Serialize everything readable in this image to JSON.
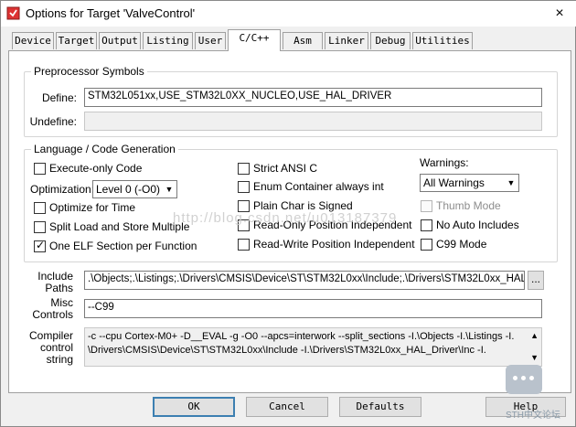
{
  "window": {
    "title": "Options for Target 'ValveControl'",
    "close_glyph": "×"
  },
  "tabs": [
    {
      "label": "Device"
    },
    {
      "label": "Target"
    },
    {
      "label": "Output"
    },
    {
      "label": "Listing"
    },
    {
      "label": "User"
    },
    {
      "label": "C/C++",
      "active": true
    },
    {
      "label": "Asm"
    },
    {
      "label": "Linker"
    },
    {
      "label": "Debug"
    },
    {
      "label": "Utilities"
    }
  ],
  "preprocessor": {
    "title": "Preprocessor Symbols",
    "define_label": "Define:",
    "define_value": "STM32L051xx,USE_STM32L0XX_NUCLEO,USE_HAL_DRIVER",
    "undefine_label": "Undefine:",
    "undefine_value": ""
  },
  "langgen": {
    "title": "Language / Code Generation",
    "execute_only": {
      "label": "Execute-only Code",
      "checked": false
    },
    "optimization_label": "Optimization:",
    "optimization_value": "Level 0 (-O0)",
    "optimize_time": {
      "label": "Optimize for Time",
      "checked": false
    },
    "split_load": {
      "label": "Split Load and Store Multiple",
      "checked": false
    },
    "one_elf": {
      "label": "One ELF Section per Function",
      "checked": true
    },
    "strict_ansi": {
      "label": "Strict ANSI C",
      "checked": false
    },
    "enum_container": {
      "label": "Enum Container always int",
      "checked": false
    },
    "plain_char": {
      "label": "Plain Char is Signed",
      "checked": false
    },
    "ro_pos_indep": {
      "label": "Read-Only Position Independent",
      "checked": false
    },
    "rw_pos_indep": {
      "label": "Read-Write Position Independent",
      "checked": false
    },
    "warnings_label": "Warnings:",
    "warnings_value": "All Warnings",
    "thumb_mode": {
      "label": "Thumb Mode",
      "checked": false,
      "disabled": true
    },
    "no_auto_includes": {
      "label": "No Auto Includes",
      "checked": false
    },
    "c99_mode": {
      "label": "C99 Mode",
      "checked": false
    }
  },
  "include_paths": {
    "label": "Include Paths",
    "value": ".\\Objects;.\\Listings;.\\Drivers\\CMSIS\\Device\\ST\\STM32L0xx\\Include;.\\Drivers\\STM32L0xx_HAL_D",
    "browse_label": "..."
  },
  "misc_controls": {
    "label": "Misc Controls",
    "value": "--C99"
  },
  "compiler_control": {
    "label": "Compiler control string",
    "line1": "-c --cpu Cortex-M0+ -D__EVAL -g -O0 --apcs=interwork --split_sections -I.\\Objects -I.\\Listings -I.",
    "line2": "\\Drivers\\CMSIS\\Device\\ST\\STM32L0xx\\Include -I.\\Drivers\\STM32L0xx_HAL_Driver\\Inc -I."
  },
  "buttons": {
    "ok": "OK",
    "cancel": "Cancel",
    "defaults": "Defaults",
    "help": "Help"
  },
  "watermark": {
    "text": "http://blog.csdn.net/u013187379",
    "badge": "STH中文论坛"
  }
}
